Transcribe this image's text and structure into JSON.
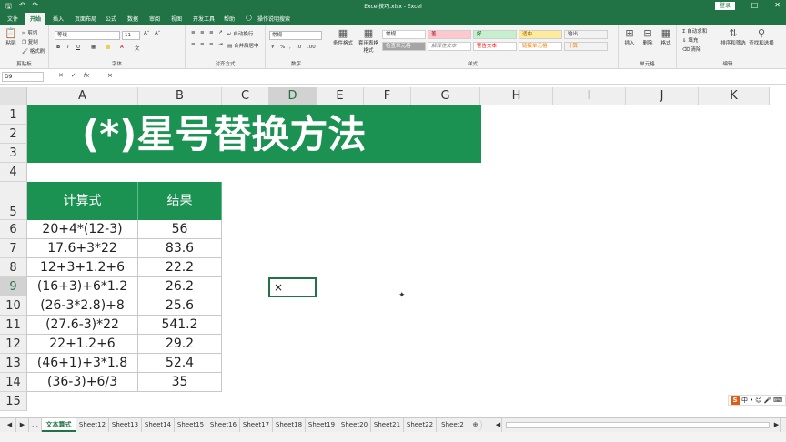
{
  "title": {
    "window": "Excel技巧.xlsx - Excel",
    "login": "登录"
  },
  "tabs": [
    "文件",
    "开始",
    "插入",
    "页面布局",
    "公式",
    "数据",
    "审阅",
    "视图",
    "开发工具",
    "帮助"
  ],
  "active_tab": "开始",
  "tell_me": "操作说明搜索",
  "ribbon": {
    "clipboard": {
      "label": "剪贴板",
      "paste": "粘贴",
      "cut": "剪切",
      "copy": "复制",
      "painter": "格式刷"
    },
    "font": {
      "label": "字体",
      "name": "等线",
      "size": "11",
      "bold": "B",
      "italic": "I",
      "underline": "U"
    },
    "align": {
      "label": "对齐方式",
      "wrap": "自动换行",
      "merge": "合并后居中"
    },
    "number": {
      "label": "数字",
      "format": "常规"
    },
    "styles": {
      "label": "样式",
      "cond": "条件格式",
      "table": "套用表格格式",
      "cells": [
        "常规",
        "差",
        "好",
        "适中",
        "检查单元格",
        "解释性文本",
        "警告文本",
        "链接单元格",
        "输出",
        "计算"
      ]
    },
    "cells": {
      "label": "单元格",
      "insert": "插入",
      "delete": "删除",
      "format": "格式"
    },
    "editing": {
      "label": "编辑",
      "autosum": "自动求和",
      "fill": "填充",
      "clear": "清除",
      "sort": "排序和筛选",
      "find": "查找和选择"
    }
  },
  "formula_bar": {
    "name_box": "D9",
    "content": "×"
  },
  "columns": [
    "A",
    "B",
    "C",
    "D",
    "E",
    "F",
    "G",
    "H",
    "I",
    "J",
    "K"
  ],
  "rows": [
    "1",
    "2",
    "3",
    "4",
    "5",
    "6",
    "7",
    "8",
    "9",
    "10",
    "11",
    "12",
    "13",
    "14",
    "15"
  ],
  "banner": "(*)星号替换方法",
  "table": {
    "headers": [
      "计算式",
      "结果"
    ],
    "rows": [
      [
        "20+4*(12-3)",
        "56"
      ],
      [
        "17.6+3*22",
        "83.6"
      ],
      [
        "12+3+1.2+6",
        "22.2"
      ],
      [
        "(16+3)+6*1.2",
        "26.2"
      ],
      [
        "(26-3*2.8)+8",
        "25.6"
      ],
      [
        "(27.6-3)*22",
        "541.2"
      ],
      [
        "22+1.2+6",
        "29.2"
      ],
      [
        "(46+1)+3*1.8",
        "52.4"
      ],
      [
        "(36-3)+6/3",
        "35"
      ]
    ]
  },
  "selected_cell": {
    "ref": "D9",
    "value": "×"
  },
  "sheets": [
    "文本算式",
    "Sheet12",
    "Sheet13",
    "Sheet14",
    "Sheet15",
    "Sheet16",
    "Sheet17",
    "Sheet18",
    "Sheet19",
    "Sheet20",
    "Sheet21",
    "Sheet22",
    "Sheet2"
  ],
  "active_sheet": "文本算式",
  "ime": {
    "lang": "中"
  },
  "colors": {
    "excel_green": "#217346",
    "banner_green": "#1b9152"
  }
}
